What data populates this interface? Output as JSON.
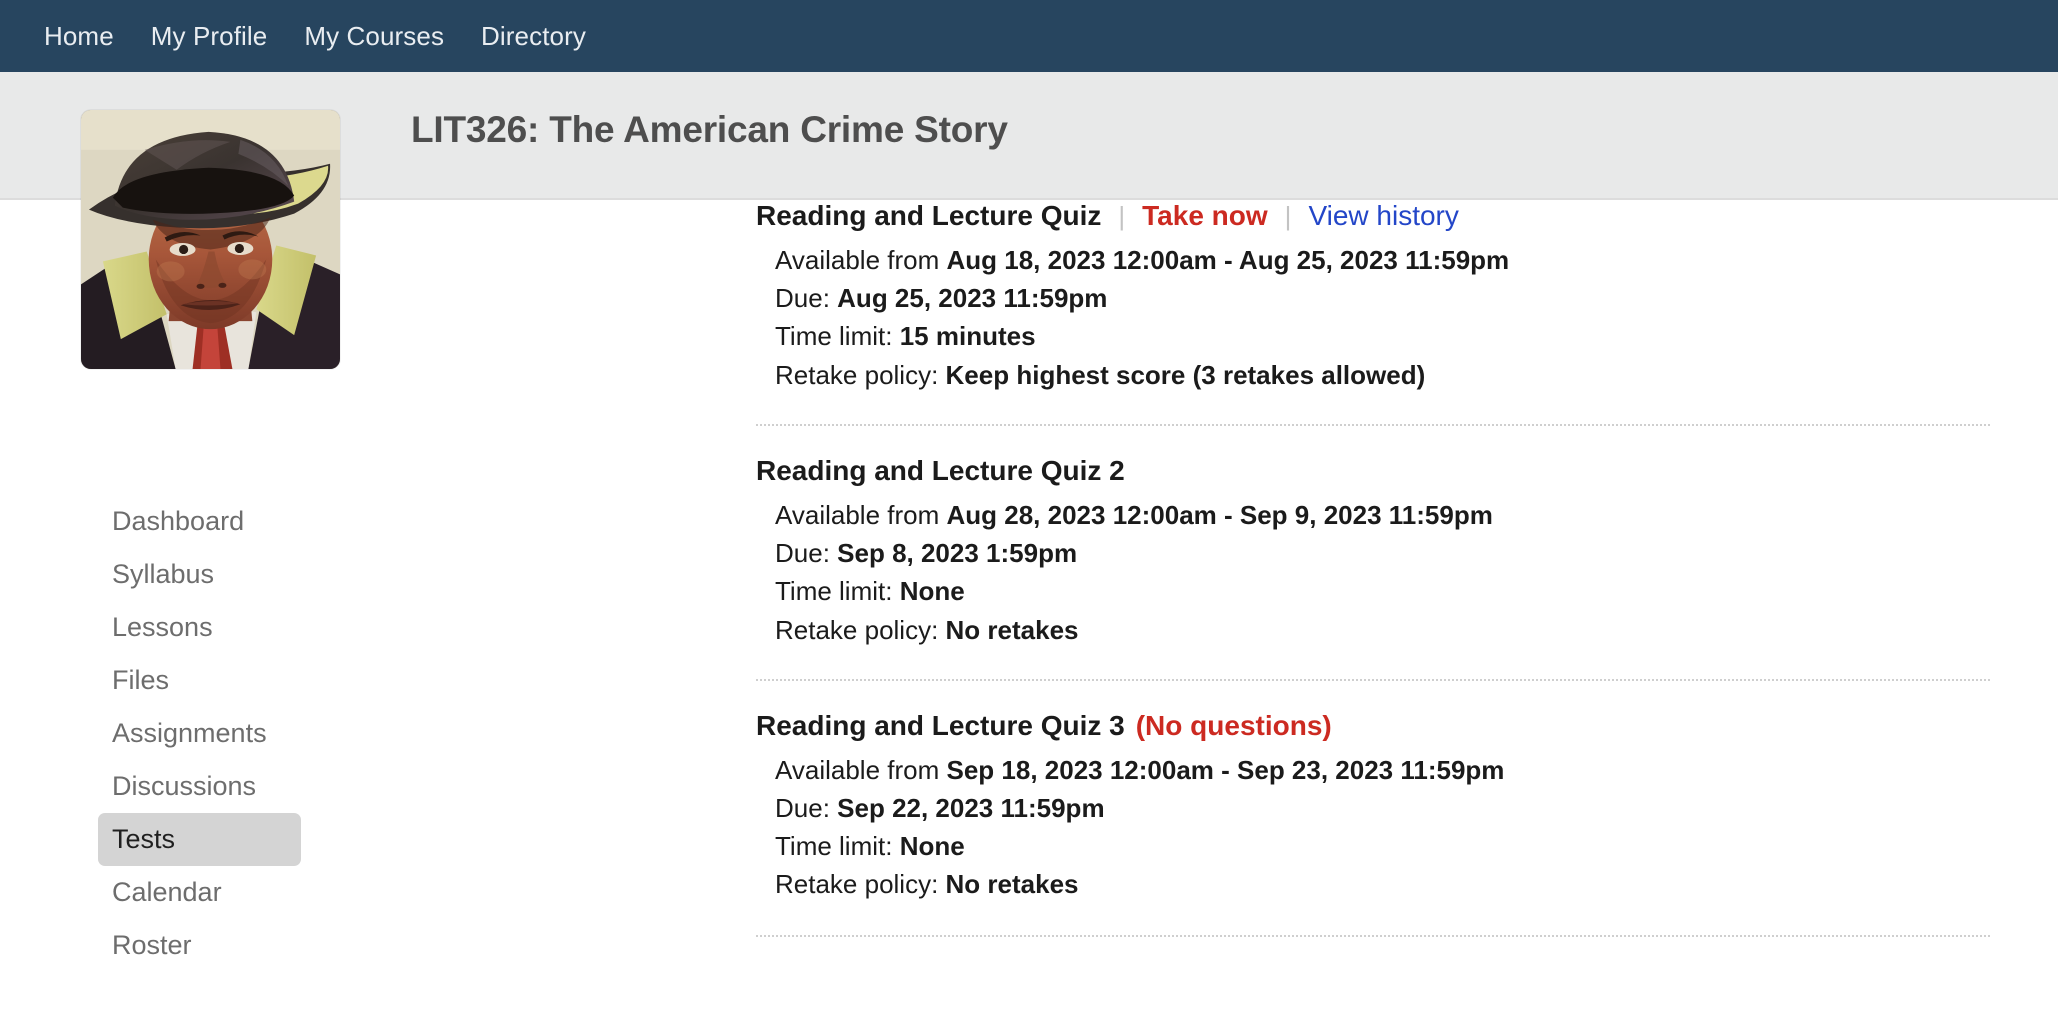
{
  "topnav": {
    "items": [
      {
        "label": "Home",
        "name": "nav-home"
      },
      {
        "label": "My Profile",
        "name": "nav-my-profile"
      },
      {
        "label": "My Courses",
        "name": "nav-my-courses"
      },
      {
        "label": "Directory",
        "name": "nav-directory"
      }
    ]
  },
  "header": {
    "course_title": "LIT326: The American Crime Story"
  },
  "sidebar": {
    "course_image_alt": "course-thumbnail-detective-fedora",
    "items": [
      {
        "label": "Dashboard",
        "active": false
      },
      {
        "label": "Syllabus",
        "active": false
      },
      {
        "label": "Lessons",
        "active": false
      },
      {
        "label": "Files",
        "active": false
      },
      {
        "label": "Assignments",
        "active": false
      },
      {
        "label": "Discussions",
        "active": false
      },
      {
        "label": "Tests",
        "active": true
      },
      {
        "label": "Calendar",
        "active": false
      },
      {
        "label": "Roster",
        "active": false
      }
    ]
  },
  "labels": {
    "available_from": "Available from",
    "due": "Due:",
    "time_limit": "Time limit:",
    "retake_policy": "Retake policy:",
    "separator": "|"
  },
  "quizzes": [
    {
      "title": "Reading and Lecture Quiz",
      "flag": "",
      "take_now": "Take now",
      "view_history": "View history",
      "available": "Aug 18, 2023 12:00am - Aug 25, 2023 11:59pm",
      "due": "Aug 25, 2023 11:59pm",
      "time_limit": "15 minutes",
      "retake_policy": "Keep highest score (3 retakes allowed)"
    },
    {
      "title": "Reading and Lecture Quiz 2",
      "flag": "",
      "take_now": "",
      "view_history": "",
      "available": "Aug 28, 2023 12:00am - Sep 9, 2023 11:59pm",
      "due": "Sep 8, 2023 1:59pm",
      "time_limit": "None",
      "retake_policy": "No retakes"
    },
    {
      "title": "Reading and Lecture Quiz 3",
      "flag": "(No questions)",
      "take_now": "",
      "view_history": "",
      "available": "Sep 18, 2023 12:00am - Sep 23, 2023 11:59pm",
      "due": "Sep 22, 2023 11:59pm",
      "time_limit": "None",
      "retake_policy": "No retakes"
    }
  ],
  "colors": {
    "navbar": "#27455f",
    "header_band": "#e8e9e9",
    "danger": "#cc2a21",
    "link": "#2346c8",
    "active_item": "#d4d4d4"
  }
}
